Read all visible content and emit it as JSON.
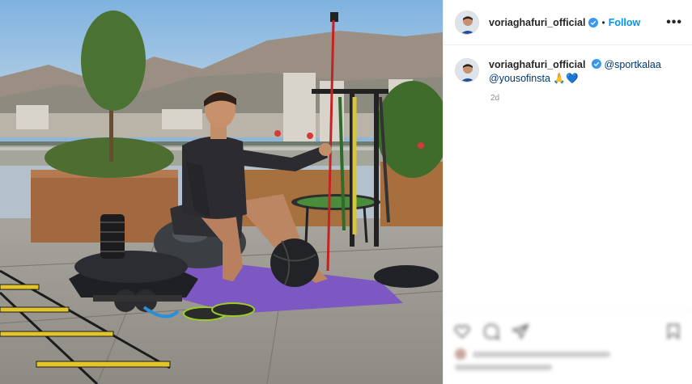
{
  "post": {
    "author": {
      "username": "voriaghafuri_official",
      "verified": true
    },
    "follow_label": "Follow",
    "separator": "•",
    "more_label": "•••",
    "caption": {
      "username": "voriaghafuri_official",
      "mention_1": "@sportkalaa",
      "mention_2": "@yousofinsta",
      "emoji": "🙏💙"
    },
    "timestamp": "2d"
  },
  "icons": {
    "verified": "verified-badge-icon",
    "heart": "heart-icon",
    "comment": "comment-icon",
    "share": "share-icon",
    "save": "bookmark-icon"
  },
  "colors": {
    "accent": "#0095f6",
    "mention": "#00376b",
    "text": "#262626",
    "muted": "#8e8e8e",
    "verified": "#3897f0"
  }
}
